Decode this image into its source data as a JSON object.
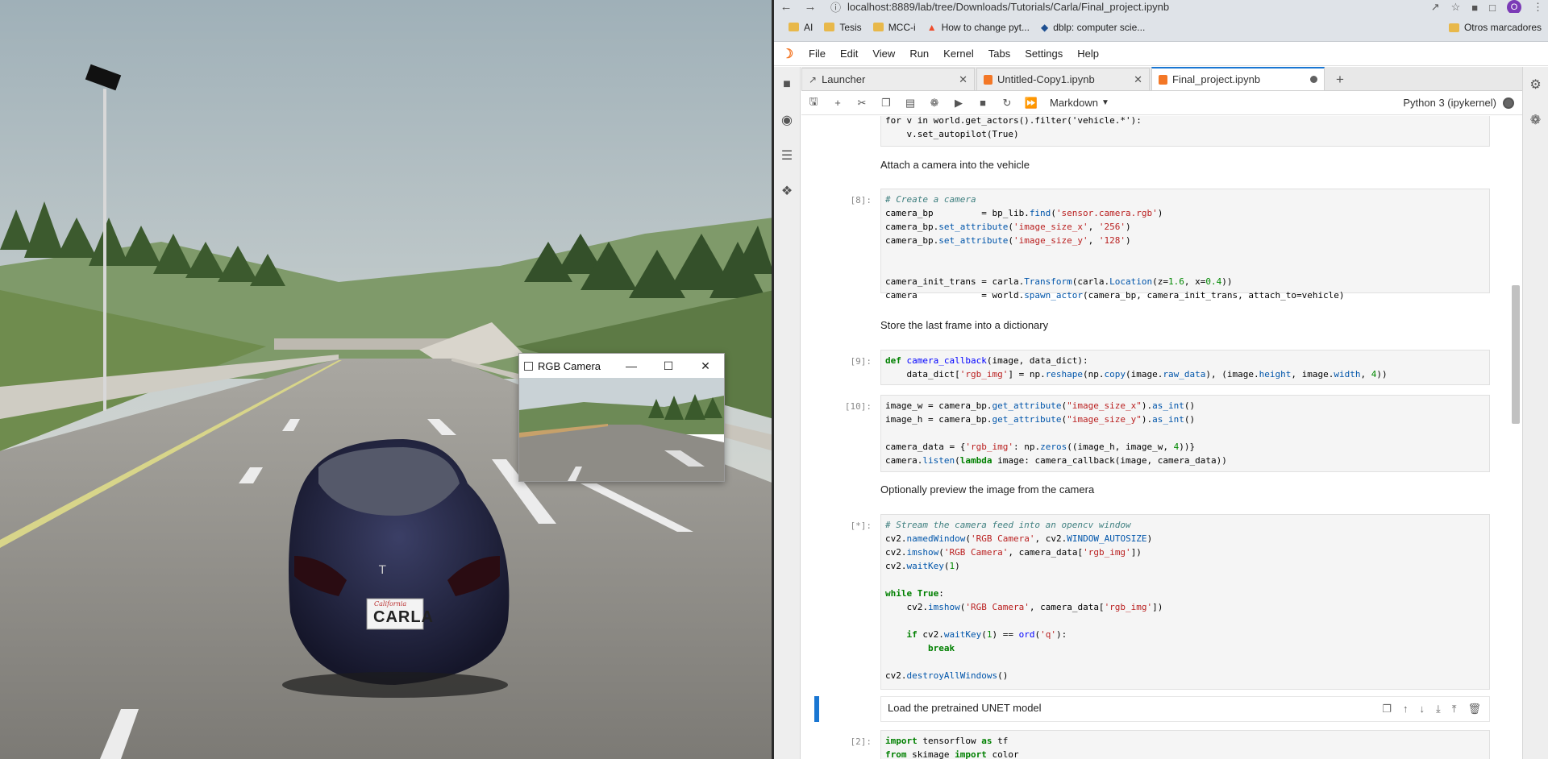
{
  "browser": {
    "url": "localhost:8889/lab/tree/Downloads/Tutorials/Carla/Final_project.ipynb",
    "profile_initial": "O",
    "bookmarks": [
      "AI",
      "Tesis",
      "MCC-i",
      "How to change pyt...",
      "dblp: computer scie..."
    ],
    "other_bookmarks": "Otros marcadores"
  },
  "jupyter": {
    "menu": [
      "File",
      "Edit",
      "View",
      "Run",
      "Kernel",
      "Tabs",
      "Settings",
      "Help"
    ],
    "tabs": [
      {
        "label": "Launcher"
      },
      {
        "label": "Untitled-Copy1.ipynb"
      },
      {
        "label": "Final_project.ipynb"
      }
    ],
    "cell_type": "Markdown",
    "kernel": "Python 3 (ipykernel)"
  },
  "cells": {
    "c0_line1": "for v in world.get_actors().filter('vehicle.*'):",
    "c0_line2": "    v.set_autopilot(True)",
    "md1": "Attach a camera into the vehicle",
    "c8_prompt": "[8]:",
    "md2": "Store the last frame into a dictionary",
    "c9_prompt": "[9]:",
    "c10_prompt": "[10]:",
    "md3": "Optionally preview the image from the camera",
    "cstar_prompt": "[*]:",
    "md4": "Load the pretrained UNET model",
    "c2_prompt": "[2]:",
    "c2_line1": "import tensorflow as tf",
    "c2_line2": "from skimage import color"
  },
  "cv_window": {
    "title": "RGB Camera"
  },
  "scene": {
    "license_plate": "CARLA",
    "plate_top": "California"
  }
}
